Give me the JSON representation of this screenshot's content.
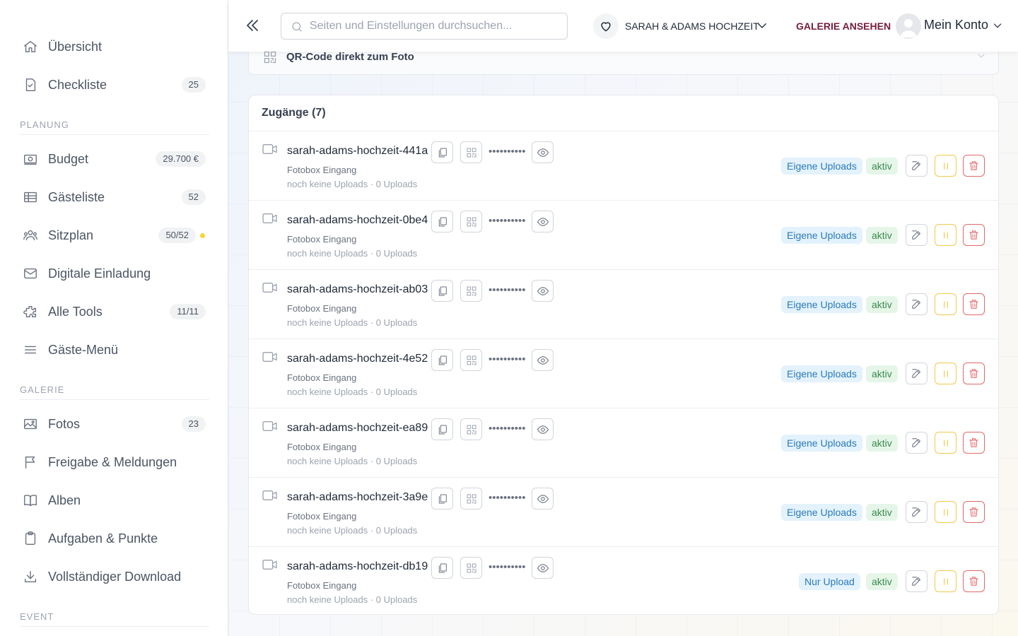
{
  "sidebar": {
    "top_items": [
      {
        "label": "Übersicht",
        "icon": "home-icon"
      },
      {
        "label": "Checkliste",
        "icon": "checklist-icon",
        "badge": "25"
      }
    ],
    "sections": [
      {
        "title": "PLANUNG",
        "items": [
          {
            "label": "Budget",
            "icon": "budget-icon",
            "badge": "29.700 €"
          },
          {
            "label": "Gästeliste",
            "icon": "guestlist-icon",
            "badge": "52"
          },
          {
            "label": "Sitzplan",
            "icon": "seating-icon",
            "badge": "50/52",
            "dot": true
          },
          {
            "label": "Digitale Einladung",
            "icon": "mail-icon"
          },
          {
            "label": "Alle Tools",
            "icon": "puzzle-icon",
            "badge": "11/11"
          },
          {
            "label": "Gäste-Menü",
            "icon": "menu-icon"
          }
        ]
      },
      {
        "title": "GALERIE",
        "items": [
          {
            "label": "Fotos",
            "icon": "photo-icon",
            "badge": "23"
          },
          {
            "label": "Freigabe & Meldungen",
            "icon": "flag-icon"
          },
          {
            "label": "Alben",
            "icon": "book-icon"
          },
          {
            "label": "Aufgaben & Punkte",
            "icon": "clipboard-icon"
          },
          {
            "label": "Vollständiger Download",
            "icon": "download-icon"
          }
        ]
      },
      {
        "title": "EVENT",
        "items": []
      }
    ]
  },
  "topbar": {
    "search_placeholder": "Seiten und Einstellungen durchsuchen...",
    "event_name": "SARAH & ADAMS HOCHZEIT",
    "gallery_link": "GALERIE ANSEHEN",
    "account_label": "Mein Konto"
  },
  "qr_section": {
    "title": "QR-Code direkt zum Foto"
  },
  "access": {
    "title": "Zugänge (7)",
    "password_mask": "••••••••••",
    "rows": [
      {
        "name": "sarah-adams-hochzeit-441a",
        "type": "Fotobox Eingang",
        "stats": "noch keine Uploads · 0 Uploads",
        "scope": "Eigene Uploads",
        "status": "aktiv"
      },
      {
        "name": "sarah-adams-hochzeit-0be4",
        "type": "Fotobox Eingang",
        "stats": "noch keine Uploads · 0 Uploads",
        "scope": "Eigene Uploads",
        "status": "aktiv"
      },
      {
        "name": "sarah-adams-hochzeit-ab03",
        "type": "Fotobox Eingang",
        "stats": "noch keine Uploads · 0 Uploads",
        "scope": "Eigene Uploads",
        "status": "aktiv"
      },
      {
        "name": "sarah-adams-hochzeit-4e52",
        "type": "Fotobox Eingang",
        "stats": "noch keine Uploads · 0 Uploads",
        "scope": "Eigene Uploads",
        "status": "aktiv"
      },
      {
        "name": "sarah-adams-hochzeit-ea89",
        "type": "Fotobox Eingang",
        "stats": "noch keine Uploads · 0 Uploads",
        "scope": "Eigene Uploads",
        "status": "aktiv"
      },
      {
        "name": "sarah-adams-hochzeit-3a9e",
        "type": "Fotobox Eingang",
        "stats": "noch keine Uploads · 0 Uploads",
        "scope": "Eigene Uploads",
        "status": "aktiv"
      },
      {
        "name": "sarah-adams-hochzeit-db19",
        "type": "Fotobox Eingang",
        "stats": "noch keine Uploads · 0 Uploads",
        "scope": "Nur Upload",
        "status": "aktiv"
      }
    ]
  },
  "colors": {
    "accent": "#7a1d3a",
    "warning": "#f2c94c",
    "danger": "#e06a6a",
    "scope_tag": "#2b7ab8",
    "status_tag": "#3d8a4e"
  }
}
